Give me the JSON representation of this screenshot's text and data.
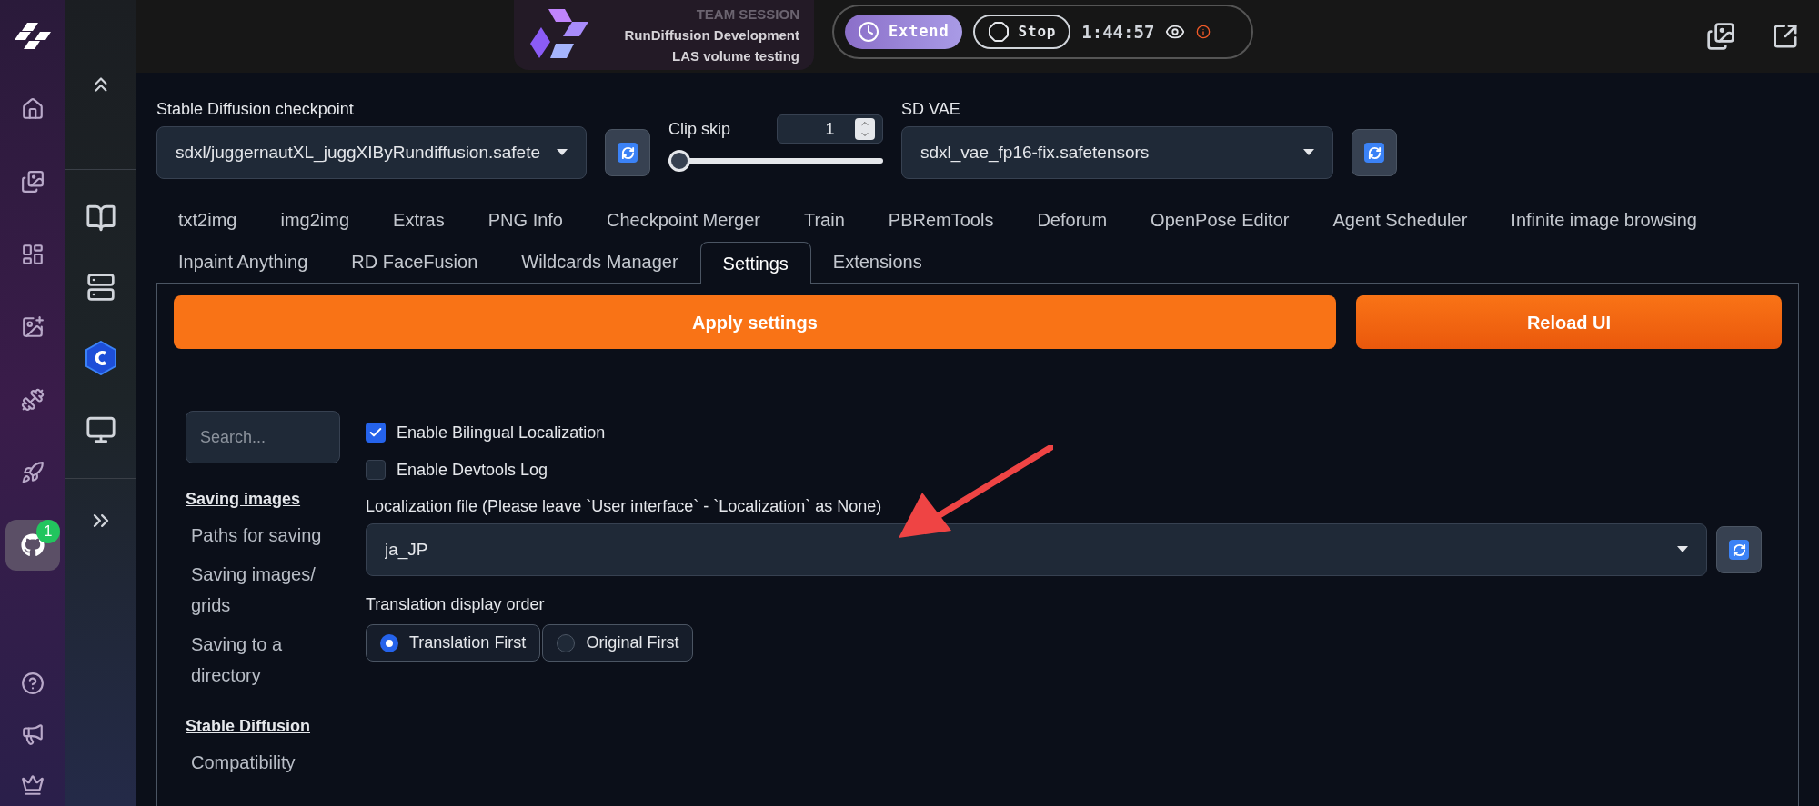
{
  "rail": {
    "items": [
      {
        "selected": false
      },
      {
        "selected": false
      },
      {
        "selected": false
      },
      {
        "selected": false
      },
      {
        "selected": false
      },
      {
        "selected": false
      },
      {
        "selected": true,
        "badge": "1"
      }
    ]
  },
  "session": {
    "label": "TEAM SESSION",
    "name": "RunDiffusion Development",
    "subtitle": "LAS volume testing"
  },
  "session_controls": {
    "extend": "Extend",
    "stop": "Stop",
    "timer": "1:44:57"
  },
  "checkpoint": {
    "label": "Stable Diffusion checkpoint",
    "value": "sdxl/juggernautXL_juggXIByRundiffusion.safete"
  },
  "clip_skip": {
    "label": "Clip skip",
    "value": "1",
    "level": 0
  },
  "vae": {
    "label": "SD VAE",
    "value": "sdxl_vae_fp16-fix.safetensors"
  },
  "tab_rows": [
    [
      {
        "label": "txt2img",
        "selected": false
      },
      {
        "label": "img2img",
        "selected": false
      },
      {
        "label": "Extras",
        "selected": false
      },
      {
        "label": "PNG Info",
        "selected": false
      },
      {
        "label": "Checkpoint Merger",
        "selected": false
      },
      {
        "label": "Train",
        "selected": false
      },
      {
        "label": "PBRemTools",
        "selected": false
      },
      {
        "label": "Deforum",
        "selected": false
      },
      {
        "label": "OpenPose Editor",
        "selected": false
      },
      {
        "label": "Agent Scheduler",
        "selected": false
      },
      {
        "label": "Infinite image browsing",
        "selected": false
      }
    ],
    [
      {
        "label": "Inpaint Anything",
        "selected": false
      },
      {
        "label": "RD FaceFusion",
        "selected": false
      },
      {
        "label": "Wildcards Manager",
        "selected": false
      },
      {
        "label": "Settings",
        "selected": true
      },
      {
        "label": "Extensions",
        "selected": false
      }
    ]
  ],
  "buttons": {
    "apply": "Apply settings",
    "reload": "Reload UI"
  },
  "settings_nav": {
    "search_placeholder": "Search...",
    "sections": [
      {
        "title": "Saving images",
        "items": [
          "Paths for saving",
          "Saving images/ grids",
          "Saving to a directory"
        ]
      },
      {
        "title": "Stable Diffusion",
        "items": [
          "Compatibility"
        ]
      }
    ]
  },
  "options": {
    "checkboxes": [
      {
        "label": "Enable Bilingual Localization",
        "checked": true
      },
      {
        "label": "Enable Devtools Log",
        "checked": false
      }
    ],
    "localization_file": {
      "label": "Localization file (Please leave `User interface` - `Localization` as None)",
      "value": "ja_JP"
    },
    "translation_order": {
      "label": "Translation display order",
      "options": [
        {
          "label": "Translation First",
          "selected": true
        },
        {
          "label": "Original First",
          "selected": false
        }
      ]
    }
  }
}
